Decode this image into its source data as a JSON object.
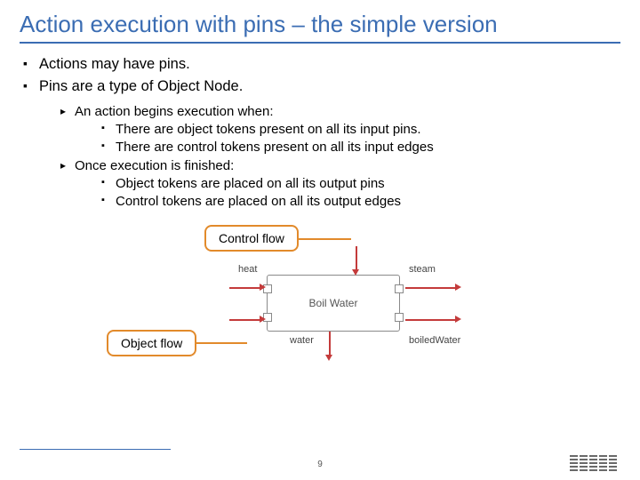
{
  "title": "Action execution with pins – the simple version",
  "bullets_l1": [
    "Actions may have pins.",
    "Pins are a type of Object Node."
  ],
  "bullets_l2": [
    "An action begins execution when:",
    "Once execution is finished:"
  ],
  "bullets_l3_group1": [
    "There are object tokens present on all its input pins.",
    "There are control tokens present on all its input edges"
  ],
  "bullets_l3_group2": [
    "Object tokens are placed on all its output pins",
    "Control tokens are placed on all its output edges"
  ],
  "diagram": {
    "control_flow_label": "Control flow",
    "object_flow_label": "Object flow",
    "action_name": "Boil Water",
    "input_pin_top": "heat",
    "input_pin_bottom": "water",
    "output_pin_top": "steam",
    "output_pin_bottom": "boiledWater"
  },
  "page_number": "9",
  "logo_text": "IBM"
}
